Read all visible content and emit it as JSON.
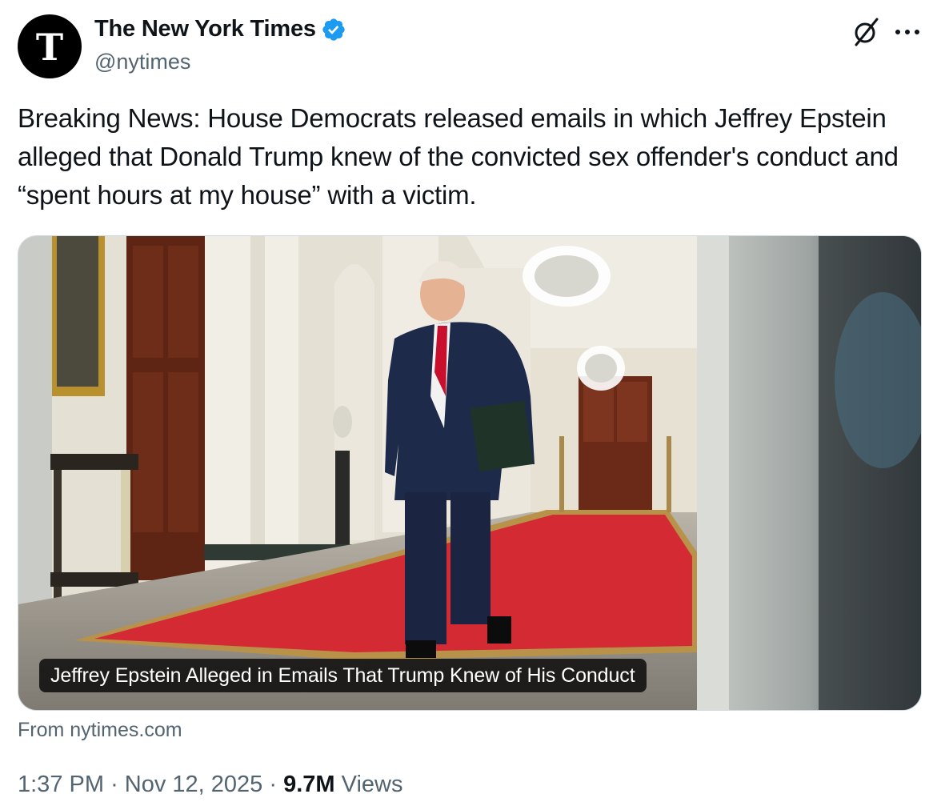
{
  "account": {
    "display_name": "The New York Times",
    "handle": "@nytimes",
    "avatar_glyph": "T"
  },
  "icons": {
    "verified": "verified-badge-icon",
    "grok": "grok-icon",
    "more": "more-options-icon"
  },
  "colors": {
    "verified_blue": "#1d9bf0",
    "muted_text": "#536471",
    "primary_text": "#0f1419"
  },
  "tweet": {
    "text": "Breaking News: House Democrats released emails in which Jeffrey Epstein alleged that Donald Trump knew of the convicted sex offender's conduct and “spent hours at my house” with a victim."
  },
  "card": {
    "title": "Jeffrey Epstein Alleged in Emails That Trump Knew of His Conduct",
    "source": "From nytimes.com"
  },
  "meta": {
    "time": "1:37 PM",
    "date": "Nov 12, 2025",
    "views_count": "9.7M",
    "views_label": "Views",
    "separator": "·"
  }
}
